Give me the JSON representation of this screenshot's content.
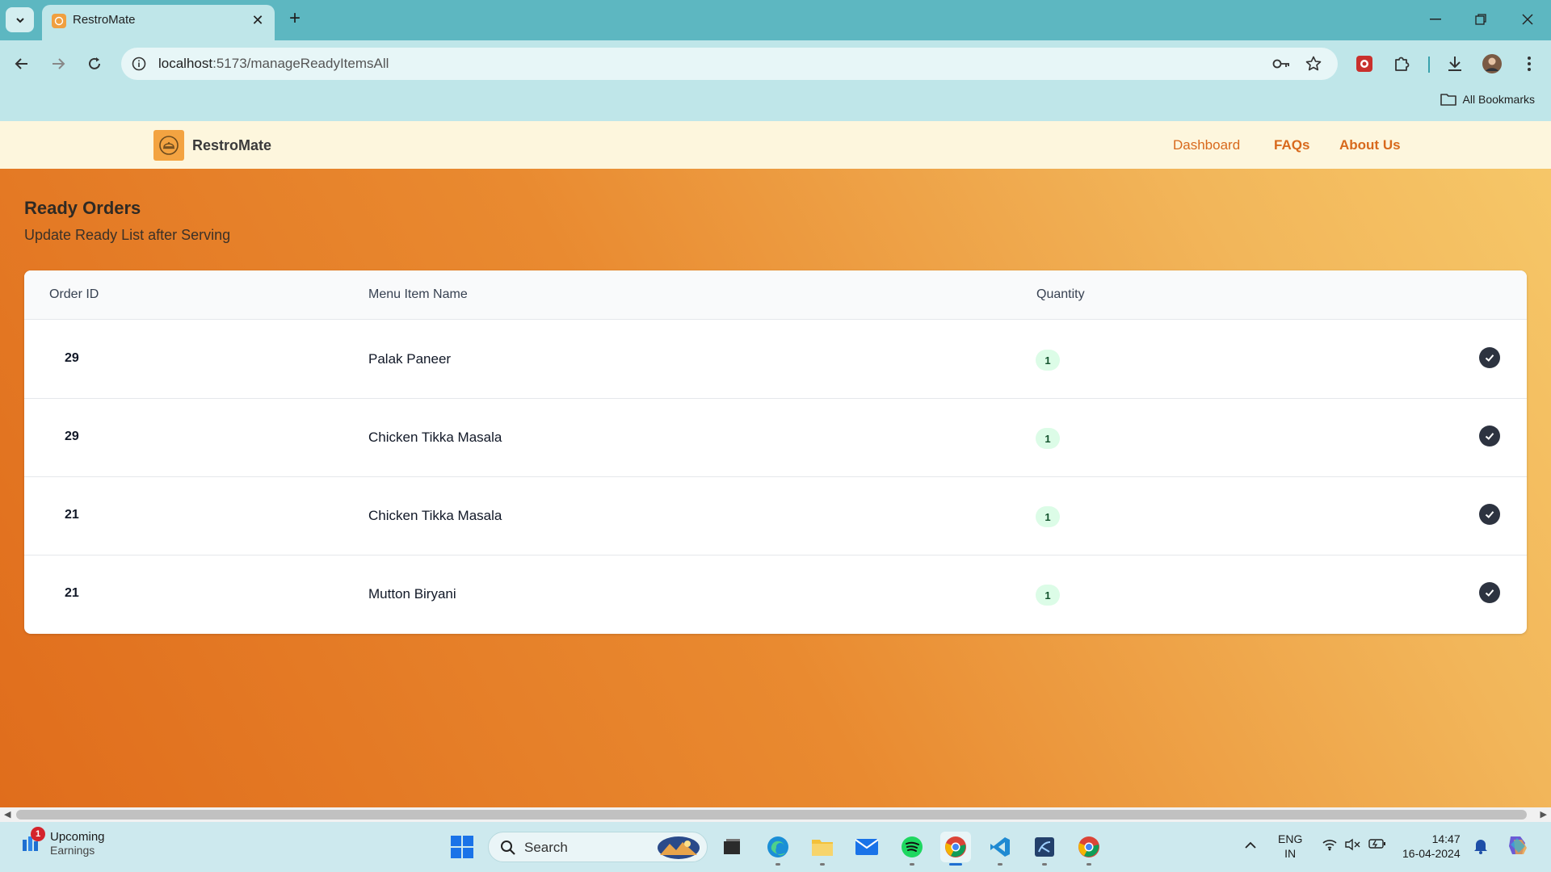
{
  "browser": {
    "tab_title": "RestroMate",
    "url_host": "localhost",
    "url_rest": ":5173/manageReadyItemsAll",
    "bookmarks_label": "All Bookmarks"
  },
  "app": {
    "brand": "RestroMate",
    "nav": [
      {
        "label": "Dashboard"
      },
      {
        "label": "FAQs"
      },
      {
        "label": "About Us"
      }
    ],
    "page_title": "Ready Orders",
    "page_subtitle": "Update Ready List after Serving",
    "table": {
      "headers": [
        "Order ID",
        "Menu Item Name",
        "Quantity"
      ],
      "rows": [
        {
          "order_id": "29",
          "item": "Palak Paneer",
          "qty": "1"
        },
        {
          "order_id": "29",
          "item": "Chicken Tikka Masala",
          "qty": "1"
        },
        {
          "order_id": "21",
          "item": "Chicken Tikka Masala",
          "qty": "1"
        },
        {
          "order_id": "21",
          "item": "Mutton Biryani",
          "qty": "1"
        }
      ]
    }
  },
  "taskbar": {
    "widget_badge": "1",
    "widget_title": "Upcoming",
    "widget_subtitle": "Earnings",
    "search_label": "Search",
    "lang_top": "ENG",
    "lang_bottom": "IN",
    "time": "14:47",
    "date": "16-04-2024"
  },
  "colors": {
    "accent_orange": "#d8691c",
    "header_bg": "#fdf6dd",
    "qty_badge_bg": "#dcfce7",
    "check_bg": "#2d3340"
  }
}
